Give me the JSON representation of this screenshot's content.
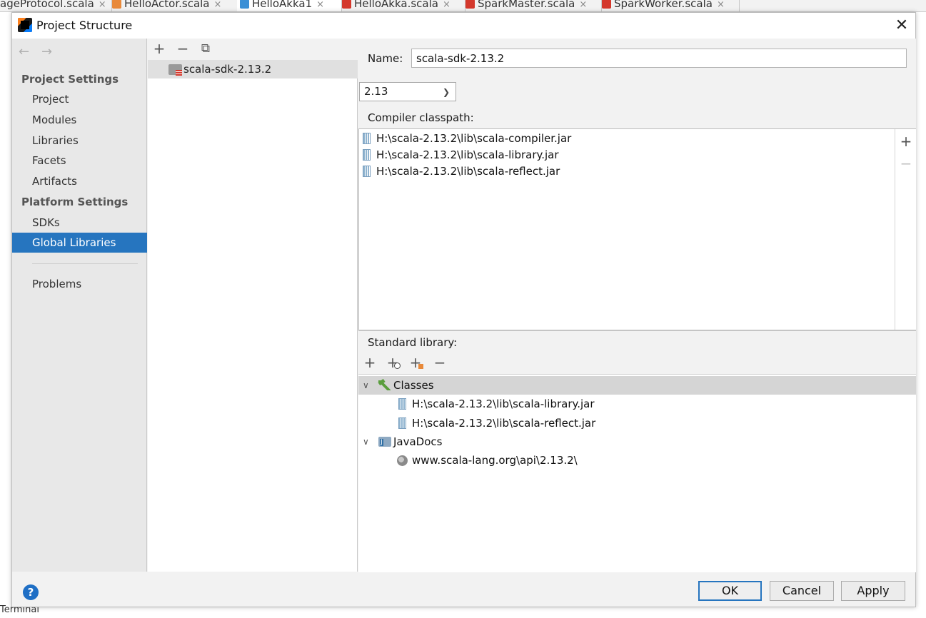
{
  "editor_tabs": [
    {
      "label": "ageProtocol.scala",
      "active": false
    },
    {
      "label": "HelloActor.scala",
      "active": false
    },
    {
      "label": "HelloAkka1",
      "active": true
    },
    {
      "label": "HelloAkka.scala",
      "active": false
    },
    {
      "label": "SparkMaster.scala",
      "active": false
    },
    {
      "label": "SparkWorker.scala",
      "active": false
    }
  ],
  "tab_close": "×",
  "bottom_tool": "Terminal",
  "dialog": {
    "title": "Project Structure",
    "close": "✕"
  },
  "sidebar": {
    "back": "←",
    "forward": "→",
    "project_settings": "Project Settings",
    "project_items": [
      "Project",
      "Modules",
      "Libraries",
      "Facets",
      "Artifacts"
    ],
    "platform_settings": "Platform Settings",
    "platform_items": [
      "SDKs",
      "Global Libraries"
    ],
    "selected": "Global Libraries",
    "problems": "Problems"
  },
  "middle": {
    "add": "+",
    "remove": "−",
    "copy": "⧉",
    "library": "scala-sdk-2.13.2"
  },
  "details": {
    "name_label": "Name:",
    "name_value": "scala-sdk-2.13.2",
    "version": "2.13",
    "compiler_label": "Compiler classpath:",
    "compiler_jars": [
      "H:\\scala-2.13.2\\lib\\scala-compiler.jar",
      "H:\\scala-2.13.2\\lib\\scala-library.jar",
      "H:\\scala-2.13.2\\lib\\scala-reflect.jar"
    ],
    "side_add": "+",
    "side_remove": "−",
    "std_label": "Standard library:",
    "std_toolbar": [
      "+",
      "+",
      "+",
      "−"
    ],
    "classes_label": "Classes",
    "classes": [
      "H:\\scala-2.13.2\\lib\\scala-library.jar",
      "H:\\scala-2.13.2\\lib\\scala-reflect.jar"
    ],
    "javadocs_label": "JavaDocs",
    "javadocs": [
      "www.scala-lang.org\\api\\2.13.2\\"
    ]
  },
  "buttons": {
    "help": "?",
    "ok": "OK",
    "cancel": "Cancel",
    "apply": "Apply"
  },
  "colors": {
    "selection": "#2675bf",
    "sidebar_bg": "#e8e8e8",
    "dialog_bg": "#f2f2f2"
  }
}
